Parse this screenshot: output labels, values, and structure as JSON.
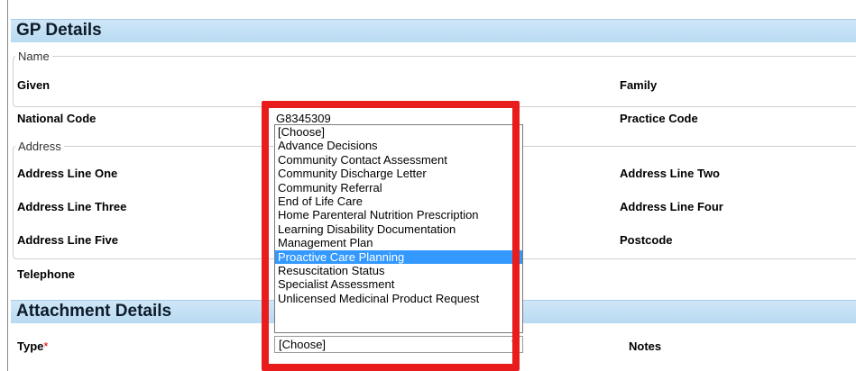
{
  "gp": {
    "title": "GP Details",
    "name_legend": "Name",
    "given_label": "Given",
    "family_label": "Family",
    "national_code_label": "National Code",
    "national_code_value": "G8345309",
    "practice_code_label": "Practice Code",
    "address_legend": "Address",
    "address_line_one_label": "Address Line One",
    "address_line_two_label": "Address Line Two",
    "address_line_three_label": "Address Line Three",
    "address_line_four_label": "Address Line Four",
    "address_line_five_label": "Address Line Five",
    "postcode_label": "Postcode",
    "telephone_label": "Telephone"
  },
  "attachment": {
    "title": "Attachment Details",
    "type_label": "Type",
    "required_marker": "*",
    "type_value": "[Choose]",
    "notes_label": "Notes"
  },
  "dropdown": {
    "selected_index": 9,
    "selected_color": "#3399ff",
    "highlight_color": "#e81c1c",
    "options": [
      "[Choose]",
      "Advance Decisions",
      "Community Contact Assessment",
      "Community Discharge Letter",
      "Community Referral",
      "End of Life Care",
      "Home Parenteral Nutrition Prescription",
      "Learning Disability Documentation",
      "Management Plan",
      "Proactive Care Planning",
      "Resuscitation Status",
      "Specialist Assessment",
      "Unlicensed Medicinal Product Request"
    ]
  }
}
